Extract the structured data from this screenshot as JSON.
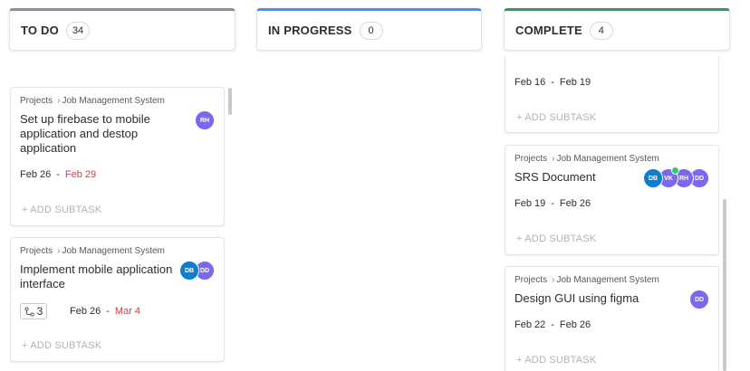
{
  "columns": [
    {
      "title": "TO DO",
      "count": "34",
      "accent": "#87909e"
    },
    {
      "title": "IN PROGRESS",
      "count": "0",
      "accent": "#4194f6"
    },
    {
      "title": "COMPLETE",
      "count": "4",
      "accent": "#2e9c5b"
    }
  ],
  "todo_cards": [
    {
      "crumb_root": "Projects",
      "crumb_project": "Job Management System",
      "name": "Set up firebase to mobile application and destop application",
      "start": "Feb 26",
      "due": "Feb 29",
      "avatars": [
        {
          "initials": "RH",
          "color": "purple"
        }
      ],
      "add_subtask": "+ ADD SUBTASK"
    },
    {
      "crumb_root": "Projects",
      "crumb_project": "Job Management System",
      "name": "Implement mobile application interface",
      "subtask_count": "3",
      "start": "Feb 26",
      "due": "Mar 4",
      "avatars": [
        {
          "initials": "DB",
          "color": "blue"
        },
        {
          "initials": "DD",
          "color": "purple"
        }
      ],
      "add_subtask": "+ ADD SUBTASK"
    }
  ],
  "complete_cards": [
    {
      "start": "Feb 16",
      "due": "Feb 19",
      "add_subtask": "+ ADD SUBTASK"
    },
    {
      "crumb_root": "Projects",
      "crumb_project": "Job Management System",
      "name": "SRS Document",
      "start": "Feb 19",
      "due": "Feb 26",
      "avatars": [
        {
          "initials": "DB",
          "color": "blue"
        },
        {
          "initials": "VK",
          "color": "purple",
          "online": true
        },
        {
          "initials": "RH",
          "color": "purple"
        },
        {
          "initials": "DD",
          "color": "purple"
        }
      ],
      "add_subtask": "+ ADD SUBTASK"
    },
    {
      "crumb_root": "Projects",
      "crumb_project": "Job Management System",
      "name": "Design GUI using figma",
      "start": "Feb 22",
      "due": "Feb 26",
      "avatars": [
        {
          "initials": "DD",
          "color": "purple"
        }
      ],
      "add_subtask": "+ ADD SUBTASK"
    }
  ],
  "dash": "-",
  "icons": {
    "crumb_separator": "chevron-right-icon",
    "subtask": "subtask-icon"
  }
}
